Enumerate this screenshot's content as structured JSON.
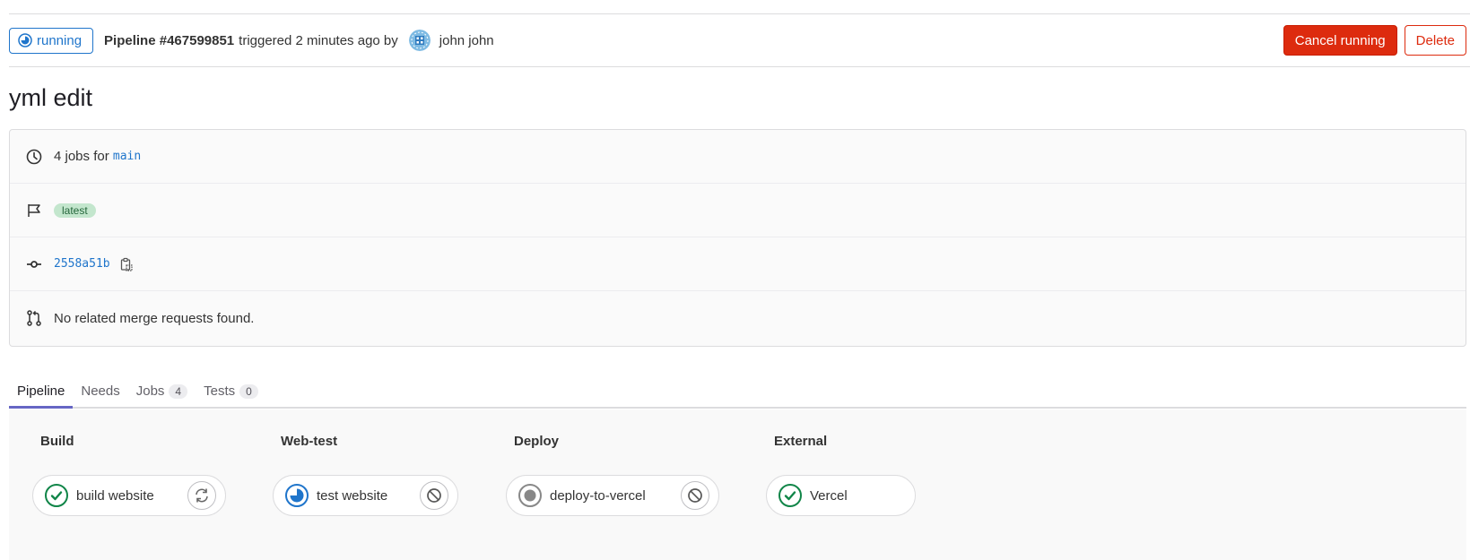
{
  "header": {
    "status": "running",
    "pipeline_id": "Pipeline #467599851",
    "triggered_text": "triggered 2 minutes ago by",
    "user_name": "john john",
    "cancel_label": "Cancel running",
    "delete_label": "Delete"
  },
  "title": "yml edit",
  "info": {
    "jobs_prefix": "4 jobs for",
    "branch": "main",
    "tag": "latest",
    "commit_sha": "2558a51b",
    "merge_requests": "No related merge requests found."
  },
  "tabs": [
    {
      "label": "Pipeline",
      "active": true
    },
    {
      "label": "Needs"
    },
    {
      "label": "Jobs",
      "count": "4"
    },
    {
      "label": "Tests",
      "count": "0"
    }
  ],
  "stages": [
    {
      "title": "Build",
      "job": {
        "name": "build website",
        "status": "success",
        "action": "retry"
      }
    },
    {
      "title": "Web-test",
      "job": {
        "name": "test website",
        "status": "running",
        "action": "cancel"
      }
    },
    {
      "title": "Deploy",
      "job": {
        "name": "deploy-to-vercel",
        "status": "created",
        "action": "cancel"
      }
    },
    {
      "title": "External",
      "job": {
        "name": "Vercel",
        "status": "success"
      }
    }
  ],
  "colors": {
    "accent_blue": "#1f75cb",
    "danger_red": "#dd2b0e",
    "success_green": "#108548",
    "tab_active": "#6666c4"
  }
}
